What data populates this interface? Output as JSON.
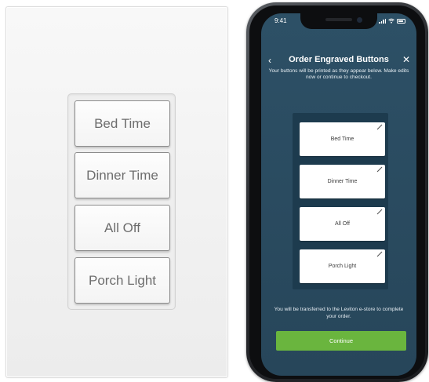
{
  "wallplate": {
    "buttons": [
      "Bed Time",
      "Dinner Time",
      "All Off",
      "Porch Light"
    ]
  },
  "phone": {
    "status_time": "9:41",
    "title": "Order Engraved Buttons",
    "back_icon": "chevron-left-icon",
    "close_icon": "close-icon",
    "instructions": "Your buttons will be printed as they appear below. Make edits now or continue to checkout.",
    "engraved_buttons": [
      "Bed Time",
      "Dinner Time",
      "All Off",
      "Porch Light"
    ],
    "transfer_text": "You will be transferred to the Leviton e-store to complete your order.",
    "continue_label": "Continue",
    "colors": {
      "screen_bg": "#2a4b60",
      "panel_bg": "#1d3b4e",
      "continue_bg": "#6ab53e"
    }
  }
}
